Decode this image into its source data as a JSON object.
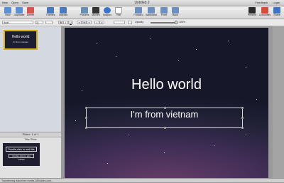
{
  "titlebar": {
    "title": "Untitled 2",
    "left_items": [
      "New",
      "Open",
      "Save"
    ],
    "right_items": [
      "Feedback",
      "Login"
    ]
  },
  "toolbar": {
    "tools": [
      {
        "label": "New",
        "icon": "new-slide-icon",
        "color": "#5b8ed6"
      },
      {
        "label": "Duplicate",
        "icon": "duplicate-icon",
        "color": "#5b8ed6"
      },
      {
        "label": "Delete",
        "icon": "delete-icon",
        "color": "#d9534f"
      },
      {
        "label": "Themes",
        "icon": "themes-icon",
        "color": "#4a79c2"
      },
      {
        "label": "Layouts",
        "icon": "layouts-icon",
        "color": "#4a79c2"
      },
      {
        "label": "Pictures",
        "icon": "pictures-icon",
        "color": "#6a8fb5"
      },
      {
        "label": "Movies",
        "icon": "movies-icon",
        "color": "#333333"
      },
      {
        "label": "Shapes",
        "icon": "shapes-icon",
        "color": "#3b73c9"
      },
      {
        "label": "Text",
        "icon": "text-icon",
        "color": "#ffffff"
      },
      {
        "label": "Forward",
        "icon": "forward-icon",
        "color": "#6d8fbf"
      },
      {
        "label": "Backward",
        "icon": "backward-icon",
        "color": "#6d8fbf"
      },
      {
        "label": "Front",
        "icon": "front-icon",
        "color": "#6d8fbf"
      },
      {
        "label": "Back",
        "icon": "back-icon",
        "color": "#6d8fbf"
      },
      {
        "label": "Present",
        "icon": "present-icon",
        "color": "#2b2b2b"
      },
      {
        "label": "Checklists",
        "icon": "checklists-icon",
        "color": "#d84a3a"
      },
      {
        "label": "Share",
        "icon": "share-icon",
        "color": "#3b73c9"
      }
    ]
  },
  "formatbar": {
    "font": "Arial",
    "size": "11",
    "opacity_label": "Opacity",
    "opacity_value": "100%"
  },
  "sidebar": {
    "thumb_title": "Hello world",
    "thumb_subtitle": "I'm from vietnam",
    "layout_header": "Slides: 1 of 1",
    "layout_name": "Title Slide",
    "layout_title_placeholder": "Double-click to add title",
    "layout_subtitle_placeholder": "Double-click to add subtitle"
  },
  "slide": {
    "title": "Hello world",
    "subtitle": "I'm from vietnam"
  },
  "status": "Transferring data from media.280slides.com..."
}
